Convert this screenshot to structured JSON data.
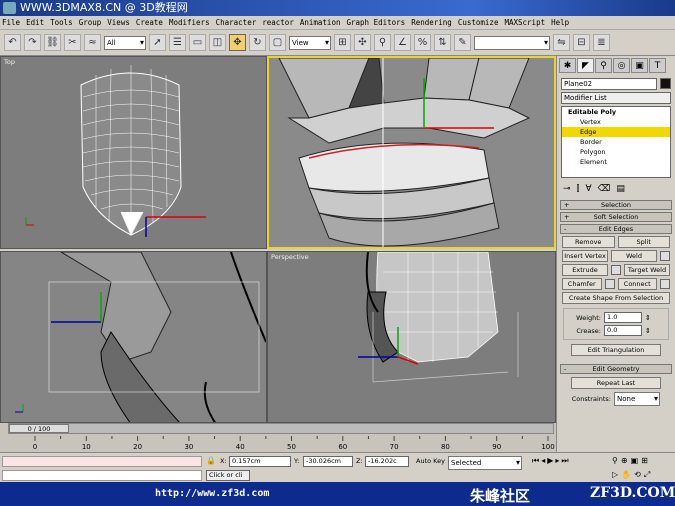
{
  "window": {
    "title": "WWW.3DMAX8.CN @ 3D教程网"
  },
  "menu": [
    "File",
    "Edit",
    "Tools",
    "Group",
    "Views",
    "Create",
    "Modifiers",
    "Character",
    "reactor",
    "Animation",
    "Graph Editors",
    "Rendering",
    "Customize",
    "MAXScript",
    "Help"
  ],
  "toolbar": {
    "filter": "All",
    "coord": "View"
  },
  "viewports": {
    "top": "Top",
    "perspective": "Perspective"
  },
  "command_panel": {
    "object_name": "Plane02",
    "modifier_list": "Modifier List",
    "stack": {
      "top": "Editable Poly",
      "items": [
        "Vertex",
        "Edge",
        "Border",
        "Polygon",
        "Element"
      ],
      "selected": "Edge"
    },
    "rollouts": {
      "selection": "Selection",
      "soft_selection": "Soft Selection",
      "edit_edges": "Edit Edges",
      "edit_geometry": "Edit Geometry"
    },
    "edit_edges": {
      "remove": "Remove",
      "split": "Split",
      "insert_vertex": "Insert Vertex",
      "weld": "Weld",
      "extrude": "Extrude",
      "target_weld": "Target Weld",
      "chamfer": "Chamfer",
      "connect": "Connect",
      "create_shape": "Create Shape From Selection",
      "weight_label": "Weight:",
      "weight": "1.0",
      "crease_label": "Crease:",
      "crease": "0.0",
      "edit_triangulation": "Edit Triangulation"
    },
    "edit_geometry": {
      "repeat_last": "Repeat Last",
      "constraints_label": "Constraints:",
      "constraints": "None"
    }
  },
  "timeline": {
    "frame": "0 / 100",
    "ticks": [
      "0",
      "10",
      "20",
      "30",
      "40",
      "50",
      "60",
      "70",
      "80",
      "90",
      "100"
    ]
  },
  "status": {
    "x_label": "X:",
    "x": "0.157cm",
    "y_label": "Y:",
    "y": "-30.026cm",
    "z_label": "Z:",
    "z": "-16.202c",
    "autokey": "Auto Key",
    "selected": "Selected",
    "click_text": "Click or cli"
  },
  "footer": {
    "url": "http://www.zf3d.com",
    "brand": "朱峰社区",
    "brand2": "ZF3D.COM"
  },
  "colors": {
    "highlight": "#f0d800",
    "viewport_bg": "#7d7d7d",
    "footer_bg": "#0d2a8e"
  }
}
